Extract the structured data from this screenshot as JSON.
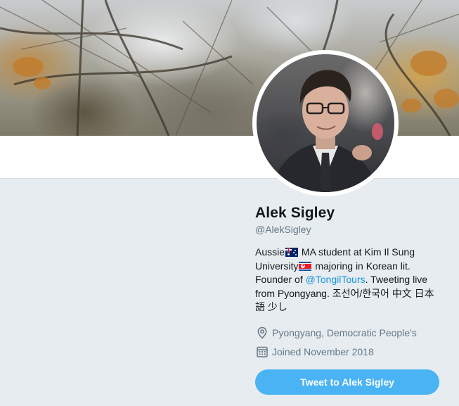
{
  "profile": {
    "name": "Alek Sigley",
    "handle": "@AlekSigley",
    "bio": {
      "part1": "Aussie",
      "flag1_icon": "australia-flag-icon",
      "part2": " MA student at Kim Il Sung University",
      "flag2_icon": "north-korea-flag-icon",
      "part3": " majoring in Korean lit. Founder of ",
      "mention": "@TongilTours",
      "part4": ". Tweeting live from Pyongyang. 조선어/한국어 中文 日本語 少し"
    },
    "location": "Pyongyang, Democratic People's",
    "location_icon": "location-pin-icon",
    "joined": "Joined November 2018",
    "joined_icon": "calendar-icon",
    "tweet_to_label": "Tweet to Alek Sigley"
  },
  "colors": {
    "page_background": "#e6ecf0",
    "link": "#1b95e0",
    "secondary_text": "#657786",
    "button": "#4ab3f4"
  }
}
